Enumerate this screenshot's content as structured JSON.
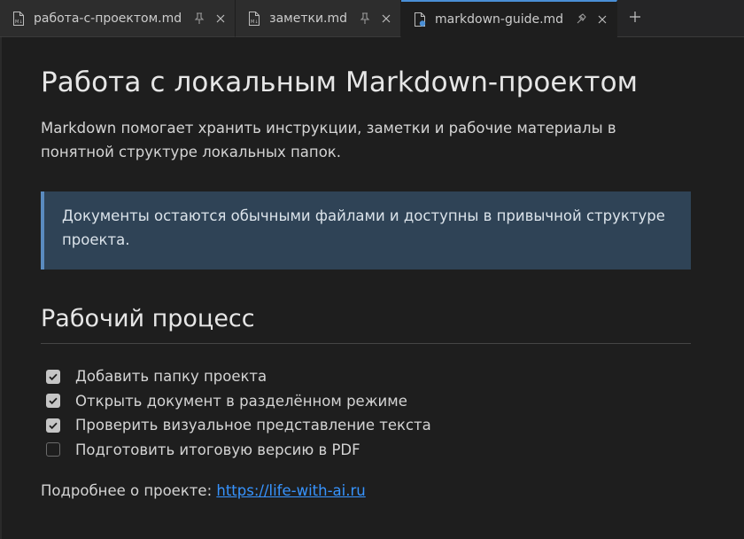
{
  "tabs": [
    {
      "label": "работа-с-проектом.md",
      "active": false
    },
    {
      "label": "заметки.md",
      "active": false
    },
    {
      "label": "markdown-guide.md",
      "active": true
    }
  ],
  "document": {
    "title": "Работа с локальным Markdown-проектом",
    "lead": "Markdown помогает хранить инструкции, заметки и рабочие материалы в понятной структуре локальных папок.",
    "callout": "Документы остаются обычными файлами и доступны в привычной структуре проекта.",
    "section_heading": "Рабочий процесс",
    "tasks": [
      {
        "label": "Добавить папку проекта",
        "checked": true
      },
      {
        "label": "Открыть документ в разделённом режиме",
        "checked": true
      },
      {
        "label": "Проверить визуальное представление текста",
        "checked": true
      },
      {
        "label": "Подготовить итоговую версию в PDF",
        "checked": false
      }
    ],
    "more_prefix": "Подробнее о проекте: ",
    "link_text": "https://life-with-ai.ru"
  },
  "icons": {
    "file": "markdown-file-icon",
    "pin": "pin-icon",
    "close": "close-icon",
    "add": "plus-icon"
  },
  "colors": {
    "accent": "#4a8fd6",
    "link": "#3794ff",
    "callout_bg": "#2f4356",
    "callout_border": "#5a8bbf"
  }
}
